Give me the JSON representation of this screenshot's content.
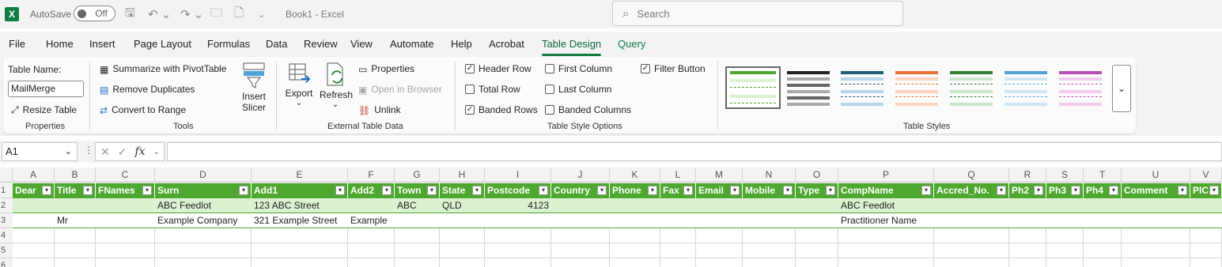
{
  "titlebar": {
    "app_letter": "X",
    "autosave_label": "AutoSave",
    "autosave_state": "Off",
    "doc_title": "Book1  -  Excel",
    "search_placeholder": "Search"
  },
  "menu": [
    "File",
    "Home",
    "Insert",
    "Page Layout",
    "Formulas",
    "Data",
    "Review",
    "View",
    "Automate",
    "Help",
    "Acrobat",
    "Table Design",
    "Query"
  ],
  "ribbon": {
    "properties": {
      "table_name_label": "Table Name:",
      "table_name_value": "MailMerge",
      "resize_label": "Resize Table",
      "group_label": "Properties"
    },
    "tools": {
      "summarize_label": "Summarize with PivotTable",
      "remove_dupes_label": "Remove Duplicates",
      "convert_label": "Convert to Range",
      "slicer_label_1": "Insert",
      "slicer_label_2": "Slicer",
      "group_label": "Tools"
    },
    "external": {
      "export_label": "Export",
      "refresh_label": "Refresh",
      "properties_label": "Properties",
      "open_browser_label": "Open in Browser",
      "unlink_label": "Unlink",
      "group_label": "External Table Data"
    },
    "style_options": {
      "header_row": {
        "label": "Header Row",
        "checked": true
      },
      "total_row": {
        "label": "Total Row",
        "checked": false
      },
      "banded_rows": {
        "label": "Banded Rows",
        "checked": true
      },
      "first_column": {
        "label": "First Column",
        "checked": false
      },
      "last_column": {
        "label": "Last Column",
        "checked": false
      },
      "banded_columns": {
        "label": "Banded Columns",
        "checked": false
      },
      "filter_button": {
        "label": "Filter Button",
        "checked": true
      },
      "group_label": "Table Style Options"
    },
    "table_styles": {
      "group_label": "Table Styles",
      "swatch_colors": [
        "#4ea72e",
        "#222222",
        "#1f5d7a",
        "#e97132",
        "#2e7d32",
        "#4ea4d8",
        "#b84fb3"
      ]
    }
  },
  "formula_bar": {
    "name_box": "A1",
    "fx_label": "fx",
    "formula": ""
  },
  "grid": {
    "columns": [
      "A",
      "B",
      "C",
      "D",
      "E",
      "F",
      "G",
      "H",
      "I",
      "J",
      "K",
      "L",
      "M",
      "N",
      "O",
      "P",
      "Q",
      "R",
      "S",
      "T",
      "U",
      "V"
    ],
    "row_numbers": [
      "1",
      "2",
      "3",
      "4",
      "5",
      "6"
    ],
    "headers": [
      "Dear",
      "Title",
      "FNames",
      "Surn",
      "Add1",
      "Add2",
      "Town",
      "State",
      "Postcode",
      "Country",
      "Phone",
      "Fax",
      "Email",
      "Mobile",
      "Type",
      "CompName",
      "Accred_No.",
      "Ph2",
      "Ph3",
      "Ph4",
      "Comment",
      "PIC"
    ],
    "rows": [
      [
        "",
        "",
        "",
        "ABC Feedlot",
        "123 ABC Street",
        "",
        "ABC",
        "QLD",
        "4123",
        "",
        "",
        "",
        "",
        "",
        "",
        "ABC Feedlot",
        "",
        "",
        "",
        "",
        "",
        ""
      ],
      [
        "",
        "Mr",
        "",
        "Example Company",
        "321 Example Street",
        "Example",
        "",
        "",
        "",
        "",
        "",
        "",
        "",
        "",
        "",
        "Practitioner Name",
        "",
        "",
        "",
        "",
        "",
        ""
      ]
    ]
  }
}
